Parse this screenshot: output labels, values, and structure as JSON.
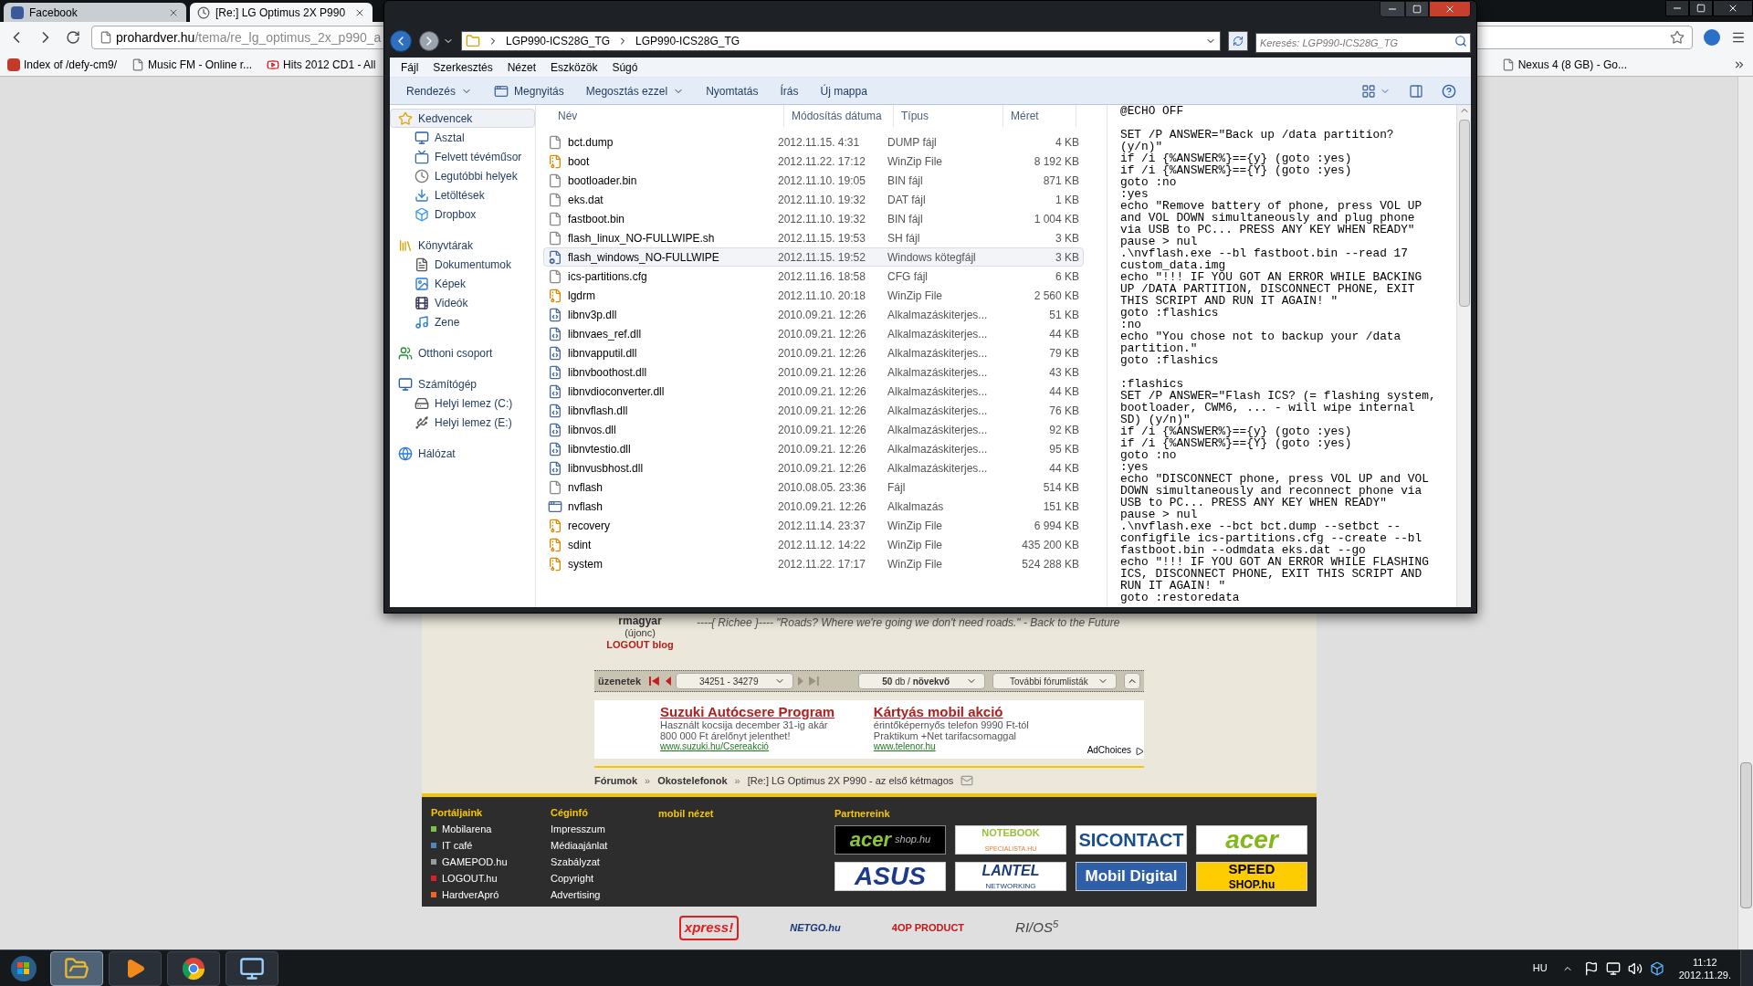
{
  "browser": {
    "tabs": [
      {
        "label": "Facebook",
        "selected": false
      },
      {
        "label": "[Re:] LG Optimus 2X P990",
        "selected": true
      }
    ],
    "url": {
      "domain": "prohardver.hu",
      "path": "/tema/re_lg_optimus_2x_p990_a"
    },
    "bookmarks": [
      {
        "label": "Index of /defy-cm9/",
        "kind": "site"
      },
      {
        "label": "Music FM - Online r...",
        "kind": "page"
      },
      {
        "label": "Hits 2012 CD1 - All",
        "kind": "video"
      }
    ],
    "bookmarks_right": [
      {
        "label": "Nexus 4 (8 GB) - Go...",
        "kind": "page"
      }
    ]
  },
  "explorer": {
    "path": [
      "LGP990-ICS28G_TG",
      "LGP990-ICS28G_TG"
    ],
    "search": {
      "placeholder": "Keresés: LGP990-ICS28G_TG"
    },
    "menu": [
      "Fájl",
      "Szerkesztés",
      "Nézet",
      "Eszközök",
      "Súgó"
    ],
    "toolbar": [
      {
        "label": "Rendezés",
        "kind": "dropdown"
      },
      {
        "label": "Megnyitás",
        "kind": "open"
      },
      {
        "label": "Megosztás ezzel",
        "kind": "dropdown"
      },
      {
        "label": "Nyomtatás",
        "kind": "plain"
      },
      {
        "label": "Írás",
        "kind": "plain"
      },
      {
        "label": "Új mappa",
        "kind": "plain"
      }
    ],
    "nav": [
      {
        "label": "Kedvencek",
        "kind": "star",
        "selected": true,
        "children": [
          {
            "label": "Asztal",
            "kind": "desktop",
            "selected": false
          },
          {
            "label": "Felvett tévéműsor",
            "kind": "tv",
            "selected": false
          },
          {
            "label": "Legutóbbi helyek",
            "kind": "recent",
            "selected": false
          },
          {
            "label": "Letöltések",
            "kind": "downloads",
            "selected": false
          },
          {
            "label": "Dropbox",
            "kind": "dropbox",
            "selected": false
          }
        ]
      },
      {
        "label": "Könyvtárak",
        "kind": "library",
        "selected": false,
        "children": [
          {
            "label": "Dokumentumok",
            "kind": "documents",
            "selected": false
          },
          {
            "label": "Képek",
            "kind": "pictures",
            "selected": false
          },
          {
            "label": "Videók",
            "kind": "videos",
            "selected": false
          },
          {
            "label": "Zene",
            "kind": "music",
            "selected": false
          }
        ]
      },
      {
        "label": "Otthoni csoport",
        "kind": "homegroup",
        "selected": false
      },
      {
        "label": "Számítógép",
        "kind": "computer",
        "selected": false,
        "children": [
          {
            "label": "Helyi lemez (C:)",
            "kind": "drive",
            "selected": false
          },
          {
            "label": "Helyi lemez (E:)",
            "kind": "removable",
            "selected": false
          }
        ]
      },
      {
        "label": "Hálózat",
        "kind": "network",
        "selected": false
      }
    ],
    "columns": [
      "Név",
      "Módosítás dátuma",
      "Típus",
      "Méret"
    ],
    "files": [
      {
        "name": "bct.dump",
        "date": "2012.11.15. 4:31",
        "type": "DUMP fájl",
        "size": "4 KB",
        "kind": "file",
        "selected": false
      },
      {
        "name": "boot",
        "date": "2012.11.22. 17:12",
        "type": "WinZip File",
        "size": "8 192 KB",
        "kind": "archive",
        "selected": false
      },
      {
        "name": "bootloader.bin",
        "date": "2012.11.10. 19:05",
        "type": "BIN fájl",
        "size": "871 KB",
        "kind": "file",
        "selected": false
      },
      {
        "name": "eks.dat",
        "date": "2012.11.10. 19:32",
        "type": "DAT fájl",
        "size": "1 KB",
        "kind": "file",
        "selected": false
      },
      {
        "name": "fastboot.bin",
        "date": "2012.11.10. 19:32",
        "type": "BIN fájl",
        "size": "1 004 KB",
        "kind": "file",
        "selected": false
      },
      {
        "name": "flash_linux_NO-FULLWIPE.sh",
        "date": "2012.11.15. 19:53",
        "type": "SH fájl",
        "size": "3 KB",
        "kind": "file",
        "selected": false
      },
      {
        "name": "flash_windows_NO-FULLWIPE",
        "date": "2012.11.15. 19:52",
        "type": "Windows kötegfájl",
        "size": "3 KB",
        "kind": "script",
        "selected": true
      },
      {
        "name": "ics-partitions.cfg",
        "date": "2012.11.16. 18:58",
        "type": "CFG fájl",
        "size": "6 KB",
        "kind": "file",
        "selected": false
      },
      {
        "name": "lgdrm",
        "date": "2012.11.10. 20:18",
        "type": "WinZip File",
        "size": "2 560 KB",
        "kind": "archive",
        "selected": false
      },
      {
        "name": "libnv3p.dll",
        "date": "2010.09.21. 12:26",
        "type": "Alkalmazáskiterjes...",
        "size": "51 KB",
        "kind": "library",
        "selected": false
      },
      {
        "name": "libnvaes_ref.dll",
        "date": "2010.09.21. 12:26",
        "type": "Alkalmazáskiterjes...",
        "size": "44 KB",
        "kind": "library",
        "selected": false
      },
      {
        "name": "libnvapputil.dll",
        "date": "2010.09.21. 12:26",
        "type": "Alkalmazáskiterjes...",
        "size": "79 KB",
        "kind": "library",
        "selected": false
      },
      {
        "name": "libnvboothost.dll",
        "date": "2010.09.21. 12:26",
        "type": "Alkalmazáskiterjes...",
        "size": "43 KB",
        "kind": "library",
        "selected": false
      },
      {
        "name": "libnvdioconverter.dll",
        "date": "2010.09.21. 12:26",
        "type": "Alkalmazáskiterjes...",
        "size": "44 KB",
        "kind": "library",
        "selected": false
      },
      {
        "name": "libnvflash.dll",
        "date": "2010.09.21. 12:26",
        "type": "Alkalmazáskiterjes...",
        "size": "76 KB",
        "kind": "library",
        "selected": false
      },
      {
        "name": "libnvos.dll",
        "date": "2010.09.21. 12:26",
        "type": "Alkalmazáskiterjes...",
        "size": "92 KB",
        "kind": "library",
        "selected": false
      },
      {
        "name": "libnvtestio.dll",
        "date": "2010.09.21. 12:26",
        "type": "Alkalmazáskiterjes...",
        "size": "95 KB",
        "kind": "library",
        "selected": false
      },
      {
        "name": "libnvusbhost.dll",
        "date": "2010.09.21. 12:26",
        "type": "Alkalmazáskiterjes...",
        "size": "44 KB",
        "kind": "library",
        "selected": false
      },
      {
        "name": "nvflash",
        "date": "2010.08.05. 23:36",
        "type": "Fájl",
        "size": "514 KB",
        "kind": "file",
        "selected": false
      },
      {
        "name": "nvflash",
        "date": "2010.09.21. 12:26",
        "type": "Alkalmazás",
        "size": "151 KB",
        "kind": "program",
        "selected": false
      },
      {
        "name": "recovery",
        "date": "2012.11.14. 23:37",
        "type": "WinZip File",
        "size": "6 994 KB",
        "kind": "archive",
        "selected": false
      },
      {
        "name": "sdint",
        "date": "2012.11.12. 14:22",
        "type": "WinZip File",
        "size": "435 200 KB",
        "kind": "archive",
        "selected": false
      },
      {
        "name": "system",
        "date": "2012.11.22. 17:17",
        "type": "WinZip File",
        "size": "524 288 KB",
        "kind": "archive",
        "selected": false
      }
    ],
    "preview": [
      [
        "@ECHO OFF"
      ],
      [
        "SET /P ANSWER=\"Back up /data partition?",
        "(y/n)\"",
        "if /i {%ANSWER%}=={y} (goto :yes)",
        "if /i {%ANSWER%}=={Y} (goto :yes)",
        "goto :no",
        ":yes",
        "echo \"Remove battery of phone, press VOL UP",
        "and VOL DOWN simultaneously and plug phone",
        "via USB to PC... PRESS ANY KEY WHEN READY\"",
        "pause > nul",
        ".\\nvflash.exe --bl fastboot.bin --read 17",
        "custom_data.img",
        "echo \"!!! IF YOU GOT AN ERROR WHILE BACKING",
        "UP /DATA PARTITION, DISCONNECT PHONE, EXIT",
        "THIS SCRIPT AND RUN IT AGAIN! \"",
        "goto :flashics",
        ":no",
        "echo \"You chose not to backup your /data",
        "partition.\"",
        "goto :flashics"
      ],
      [
        ":flashics",
        "SET /P ANSWER=\"Flash ICS? (= flashing system,",
        "bootloader, CWM6, ... - will wipe internal",
        "SD) (y/n)\"",
        "if /i {%ANSWER%}=={y} (goto :yes)",
        "if /i {%ANSWER%}=={Y} (goto :yes)",
        "goto :no",
        ":yes",
        "echo \"DISCONNECT phone, press VOL UP and VOL",
        "DOWN simultaneously and reconnect phone via",
        "USB to PC... PRESS ANY KEY WHEN READY\"",
        "pause > nul",
        ".\\nvflash.exe --bct bct.dump --setbct --",
        "configfile ics-partitions.cfg --create --bl",
        "fastboot.bin --odmdata eks.dat --go",
        "echo \"!!! IF YOU GOT AN ERROR WHILE FLASHING",
        "ICS, DISCONNECT PHONE, EXIT THIS SCRIPT AND",
        "RUN IT AGAIN! \"",
        "goto :restoredata"
      ]
    ]
  },
  "page": {
    "post": {
      "user": "rmagyar",
      "rank": "(újonc)",
      "blog": "LOGOUT blog",
      "signature": "----{ Richee }----  \"Roads? Where we're going we don't need roads.\"  - Back to the Future"
    },
    "pager": {
      "label": "üzenetek",
      "range": "34251 - 34279",
      "per_page": "**50** db / **növekvő**",
      "more": "További fórumlisták"
    },
    "ads": [
      {
        "title": "Suzuki Autócsere Program",
        "lines": [
          "Használt kocsija december 31-ig akár",
          "800 000 Ft árelőnyt jelenthet!"
        ],
        "url": "www.suzuki.hu/Csereakció"
      },
      {
        "title": "Kártyás mobil akció",
        "lines": [
          "érintőképernyős telefon 9990 Ft-tól",
          "Praktikum +Net tarifacsomaggal"
        ],
        "url": "www.telenor.hu"
      }
    ],
    "adchoices": "AdChoices",
    "breadcrumb": [
      {
        "label": "Fórumok",
        "kind": "link"
      },
      {
        "label": "»",
        "kind": "sep"
      },
      {
        "label": "Okostelefonok",
        "kind": "link"
      },
      {
        "label": "»",
        "kind": "sep"
      },
      {
        "label": "[Re:] LG Optimus 2X P990 - az első kétmagos",
        "kind": "current"
      }
    ],
    "footer": {
      "portals": {
        "title": "Portáljaink",
        "items": [
          {
            "label": "Mobilarena",
            "color": "#7cc242"
          },
          {
            "label": "IT café",
            "color": "#4a86c5"
          },
          {
            "label": "GAMEPOD.hu",
            "color": "#9a9a9a"
          },
          {
            "label": "LOGOUT.hu",
            "color": "#d2232a"
          },
          {
            "label": "HardverApró",
            "color": "#f26522"
          }
        ]
      },
      "company": {
        "title": "Céginfó",
        "items": [
          "Impresszum",
          "Médiaajánlat",
          "Szabályzat",
          "Copyright",
          "Advertising"
        ]
      },
      "mobile": "mobil nézet",
      "partners": {
        "title": "Partnereink",
        "items": [
          {
            "text": "acer",
            "sub": "shop.hu",
            "kind": "acershop"
          },
          {
            "text": "NOTEBOOK",
            "sub": "SPECIALISTA.HU",
            "kind": "notebook"
          },
          {
            "text": "SICONTACT",
            "kind": "sicontact"
          },
          {
            "text": "acer",
            "kind": "acer"
          },
          {
            "text": "ASUS",
            "kind": "asus"
          },
          {
            "text": "LANTEL",
            "sub": "NETWORKING",
            "kind": "lantel"
          },
          {
            "text": "Mobil Digital",
            "kind": "mobildigital"
          },
          {
            "text": "SPEED",
            "sub": "SHOP.hu",
            "kind": "speed"
          }
        ]
      }
    },
    "sponsors": [
      {
        "text": "xpress!",
        "kind": "xpress"
      },
      {
        "text": "NETGO.hu",
        "kind": "netgo"
      },
      {
        "text": "4OP PRODUCT",
        "kind": "fourop"
      },
      {
        "text": "RI/OS$^{5}$",
        "kind": "rios"
      }
    ]
  },
  "taskbar": {
    "apps": [
      {
        "kind": "folder",
        "selected": true
      },
      {
        "kind": "media",
        "selected": false
      },
      {
        "kind": "browser",
        "selected": false
      },
      {
        "kind": "app",
        "selected": false
      }
    ],
    "language": "HU",
    "time": "11:12",
    "date": "2012.11.29."
  }
}
